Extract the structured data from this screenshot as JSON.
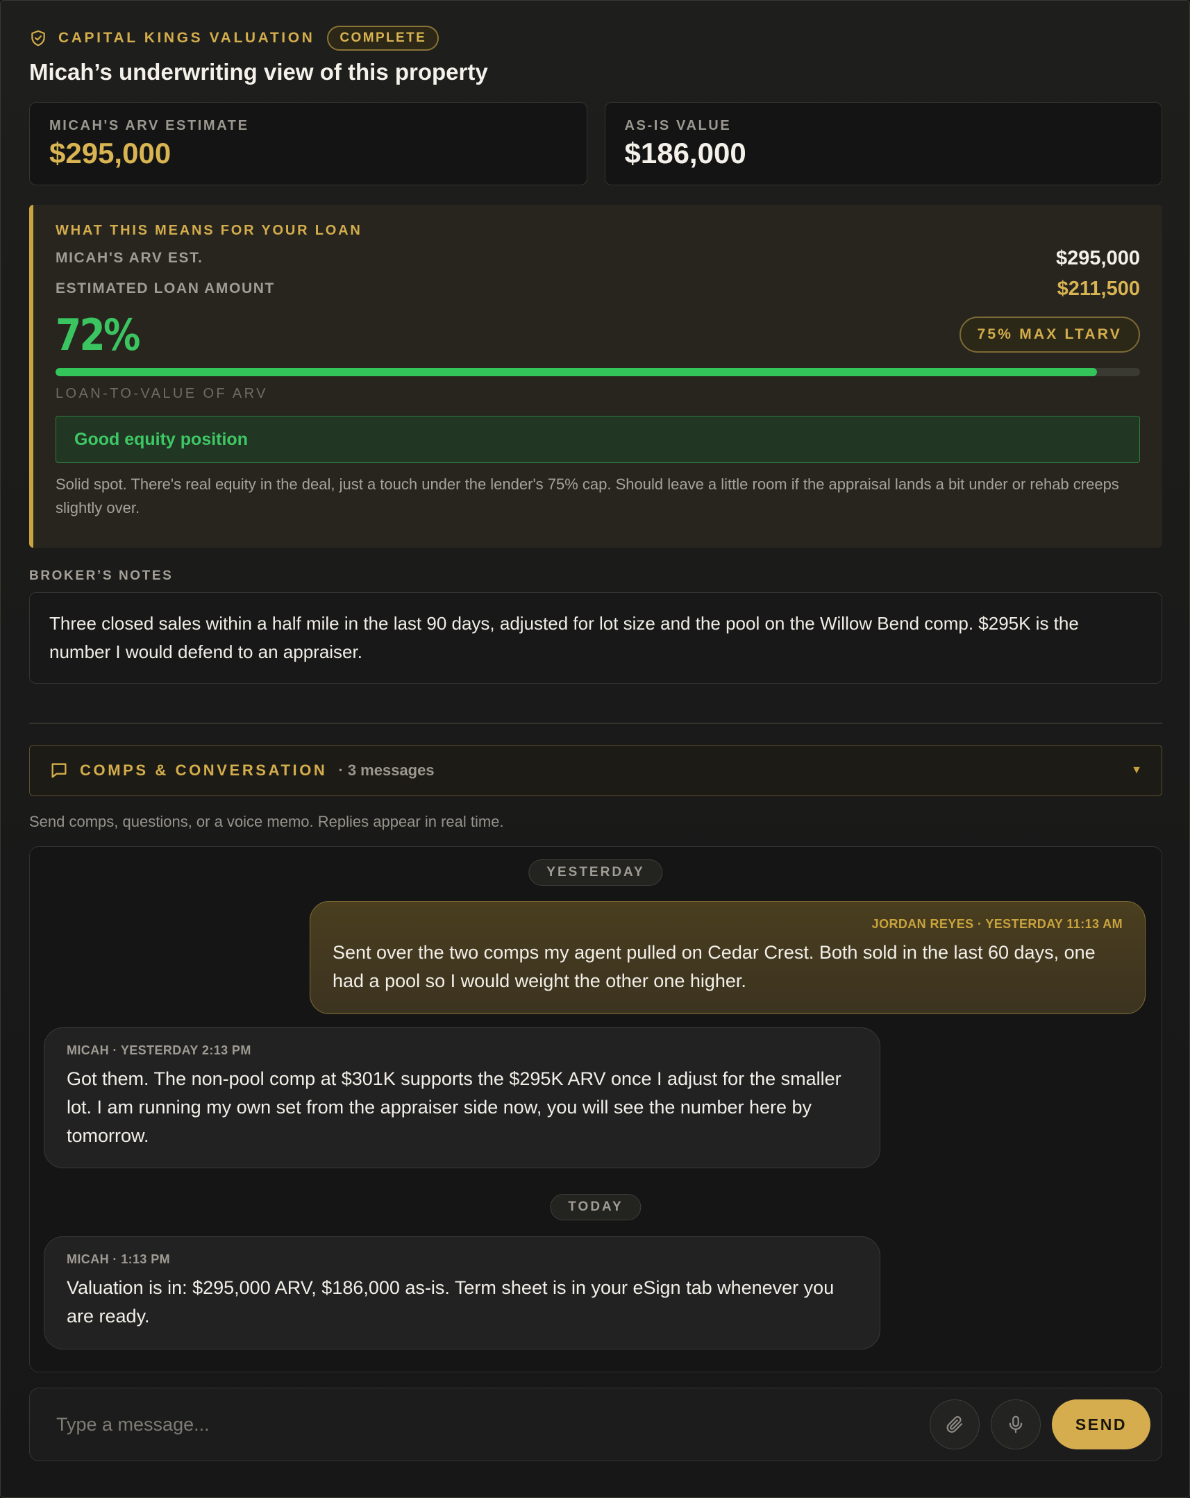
{
  "header": {
    "brand": "CAPITAL KINGS VALUATION",
    "status_badge": "COMPLETE",
    "title": "Micah’s underwriting view of this property"
  },
  "valuation": {
    "arv_label": "MICAH'S ARV ESTIMATE",
    "arv_value": "$295,000",
    "as_is_label": "AS-IS VALUE",
    "as_is_value": "$186,000"
  },
  "loan_panel": {
    "heading": "WHAT THIS MEANS FOR YOUR LOAN",
    "arv_label": "MICAH'S ARV EST.",
    "arv_value": "$295,000",
    "loan_label": "ESTIMATED LOAN AMOUNT",
    "loan_value": "$211,500",
    "ltv_percent_text": "72%",
    "ltv_fraction": 0.96,
    "max_badge": "75% MAX LTARV",
    "progress_caption": "LOAN-TO-VALUE OF ARV",
    "equity_title": "Good equity position",
    "equity_description": "Solid spot. There's real equity in the deal, just a touch under the lender's 75% cap. Should leave a little room if the appraisal lands a bit under or rehab creeps slightly over."
  },
  "notes": {
    "label": "BROKER’S NOTES",
    "text": "Three closed sales within a half mile in the last 90 days, adjusted for lot size and the pool on the Willow Bend comp. $295K is the number I would defend to an appraiser."
  },
  "comps": {
    "title": "COMPS & CONVERSATION",
    "count": "· 3 messages",
    "help_text": "Send comps, questions, or a voice memo. Replies appear in real time."
  },
  "chat": {
    "day_yesterday": "YESTERDAY",
    "day_today": "TODAY",
    "messages": [
      {
        "meta": "JORDAN REYES · YESTERDAY 11:13 AM",
        "text": "Sent over the two comps my agent pulled on Cedar Crest. Both sold in the last 60 days, one had a pool so I would weight the other one higher."
      },
      {
        "meta": "MICAH · YESTERDAY 2:13 PM",
        "text": "Got them. The non-pool comp at $301K supports the $295K ARV once I adjust for the smaller lot. I am running my own set from the appraiser side now, you will see the number here by tomorrow."
      },
      {
        "meta": "MICAH · 1:13 PM",
        "text": "Valuation is in: $295,000 ARV, $186,000 as-is. Term sheet is in your eSign tab whenever you are ready."
      }
    ]
  },
  "composer": {
    "placeholder": "Type a message...",
    "send_label": "SEND"
  },
  "icons": {
    "shield": "shield-check-icon",
    "chat": "chat-bubble-icon",
    "attach": "paperclip-icon",
    "mic": "microphone-icon",
    "chevron": "chevron-down-icon"
  },
  "colors": {
    "accent_gold": "#d4ad4c",
    "success_green": "#33c45a"
  }
}
